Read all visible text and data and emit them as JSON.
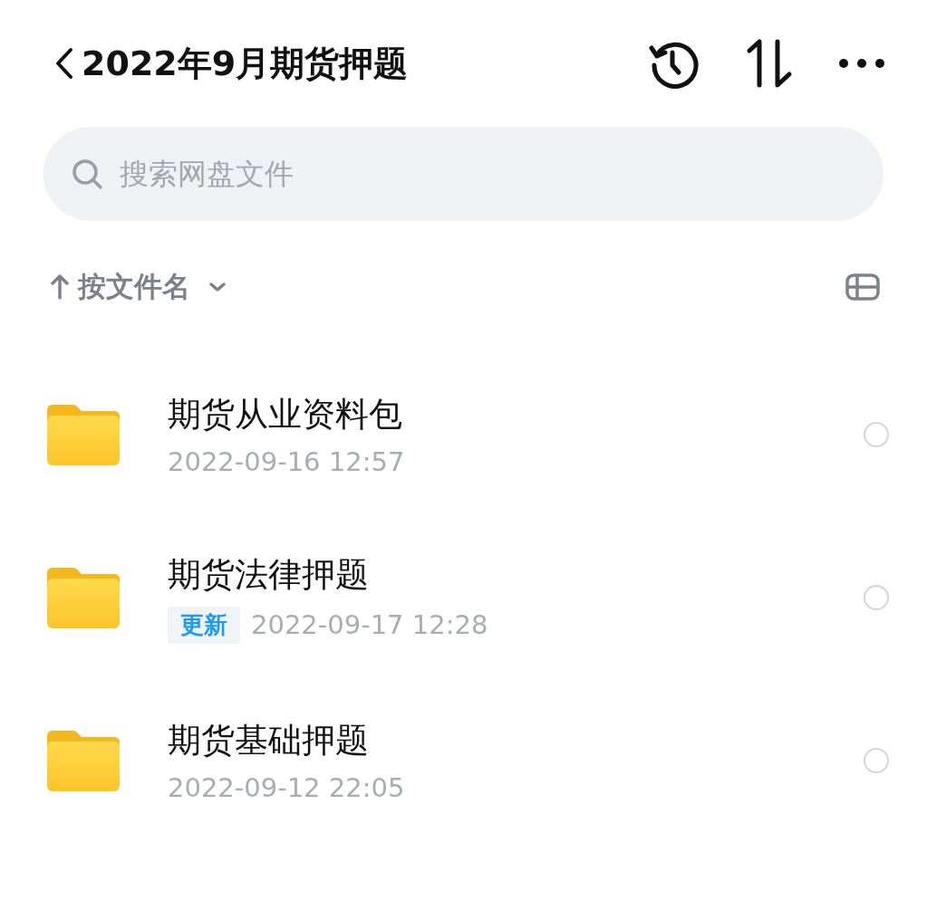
{
  "header": {
    "title": "2022年9月期货押题"
  },
  "search": {
    "placeholder": "搜索网盘文件"
  },
  "sort": {
    "label": "按文件名"
  },
  "files": [
    {
      "name": "期货从业资料包",
      "date": "2022-09-16 12:57",
      "selected": false
    },
    {
      "name": "期货法律押题",
      "badge": "更新",
      "date": "2022-09-17 12:28",
      "selected": false
    },
    {
      "name": "期货基础押题",
      "date": "2022-09-12 22:05",
      "selected": false
    }
  ]
}
